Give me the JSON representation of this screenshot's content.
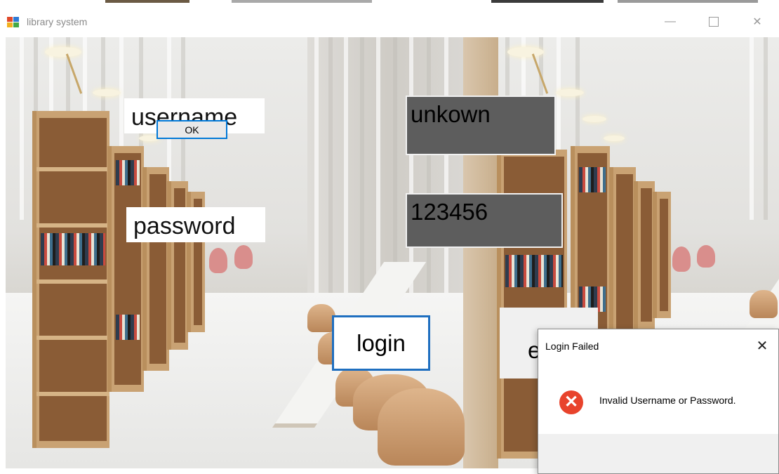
{
  "window": {
    "title": "library system",
    "controls": {
      "minimize_icon": "minimize-icon",
      "maximize_icon": "maximize-icon",
      "close_icon": "close-icon"
    }
  },
  "form": {
    "username_label": "username",
    "username_value": "unkown",
    "password_label": "password",
    "password_value": "123456",
    "login_button": "login",
    "second_button_partial": "e"
  },
  "dialog": {
    "title": "Login Failed",
    "message": "Invalid Username or Password.",
    "ok_button": "OK",
    "icon": "error-icon",
    "close_icon": "close-icon"
  },
  "colors": {
    "textbox_bg": "#5d5d5d",
    "focus_border": "#1f6fc0",
    "error_red": "#e8432c",
    "ok_border": "#0078d7"
  }
}
